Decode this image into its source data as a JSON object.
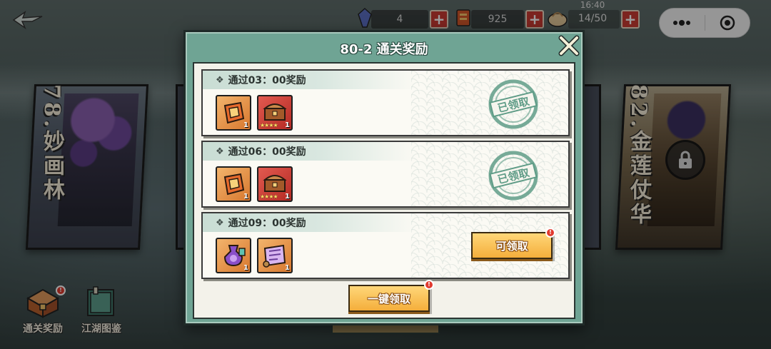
{
  "topbar": {
    "resource_1_value": "4",
    "resource_2_value": "925",
    "stamina_timer": "16:40",
    "stamina_value": "14/50",
    "plus_label": "+"
  },
  "background": {
    "left_stage_name": "78.妙画林",
    "right_stage_name": "82.金莲仗华"
  },
  "modal": {
    "title": "80-2 通关奖励",
    "rows": [
      {
        "header": "通过03：00奖励",
        "items": [
          {
            "icon": "scroll-token-icon",
            "qty": "1",
            "stars": ""
          },
          {
            "icon": "treasure-chest-icon",
            "qty": "1",
            "stars": "★★★★"
          }
        ],
        "status": "claimed",
        "stamp_label": "已领取"
      },
      {
        "header": "通过06：00奖励",
        "items": [
          {
            "icon": "scroll-token-icon",
            "qty": "1",
            "stars": ""
          },
          {
            "icon": "treasure-chest-icon",
            "qty": "1",
            "stars": "★★★★"
          }
        ],
        "status": "claimed",
        "stamp_label": "已领取"
      },
      {
        "header": "通过09：00奖励",
        "items": [
          {
            "icon": "purple-potion-icon",
            "qty": "1",
            "stars": ""
          },
          {
            "icon": "map-scroll-icon",
            "qty": "1",
            "stars": ""
          }
        ],
        "status": "claimable",
        "claim_label": "可领取"
      }
    ],
    "claim_all_label": "一键领取"
  },
  "bottom_buttons": {
    "clear_reward_label": "通关奖励",
    "atlas_label": "江湖图鉴"
  },
  "colors": {
    "modal_green": "#6fa494",
    "claim_orange": "#f4ae3b",
    "stamp_green": "#5f9c87",
    "alert_red": "#e13a2e"
  }
}
